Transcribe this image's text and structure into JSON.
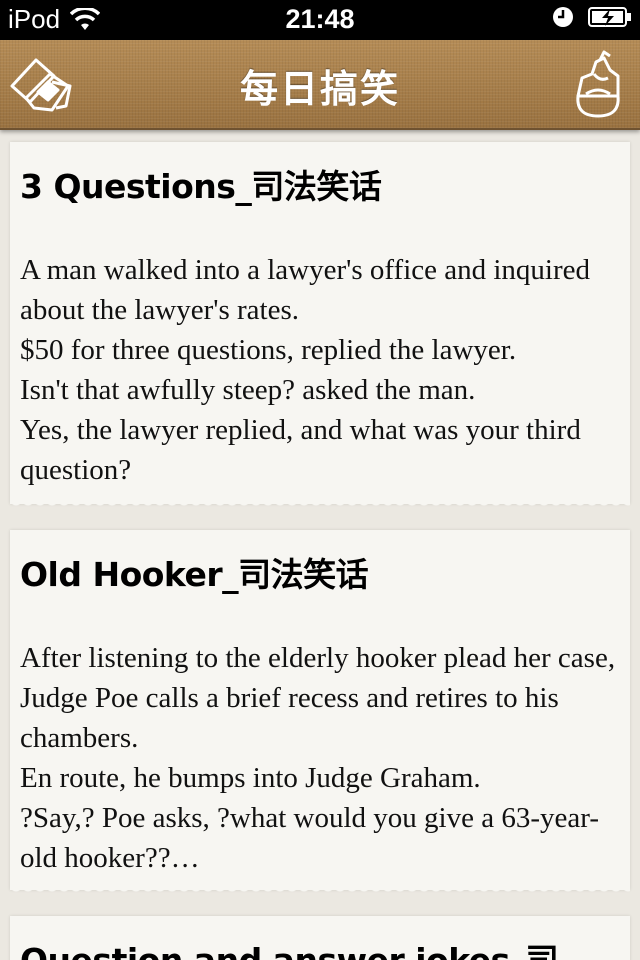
{
  "status_bar": {
    "carrier": "iPod",
    "time": "21:48"
  },
  "nav": {
    "title": "每日搞笑"
  },
  "articles": [
    {
      "title": "3 Questions_司法笑话",
      "lines": [
        "A man walked into a lawyer's office and inquired about the lawyer's rates.",
        "$50 for three questions, replied the lawyer.",
        "Isn't that awfully steep? asked the man.",
        "Yes, the lawyer replied, and what was your third question?"
      ]
    },
    {
      "title": "Old Hooker_司法笑话",
      "lines": [
        "After listening to the elderly hooker plead her case, Judge Poe calls a brief recess and retires to his chambers.",
        "En route, he bumps into Judge Graham.",
        "?Say,? Poe asks, ?what would you give a 63-year-old hooker??…"
      ]
    },
    {
      "title": "Question and answer jokes_司法…",
      "lines": []
    }
  ]
}
